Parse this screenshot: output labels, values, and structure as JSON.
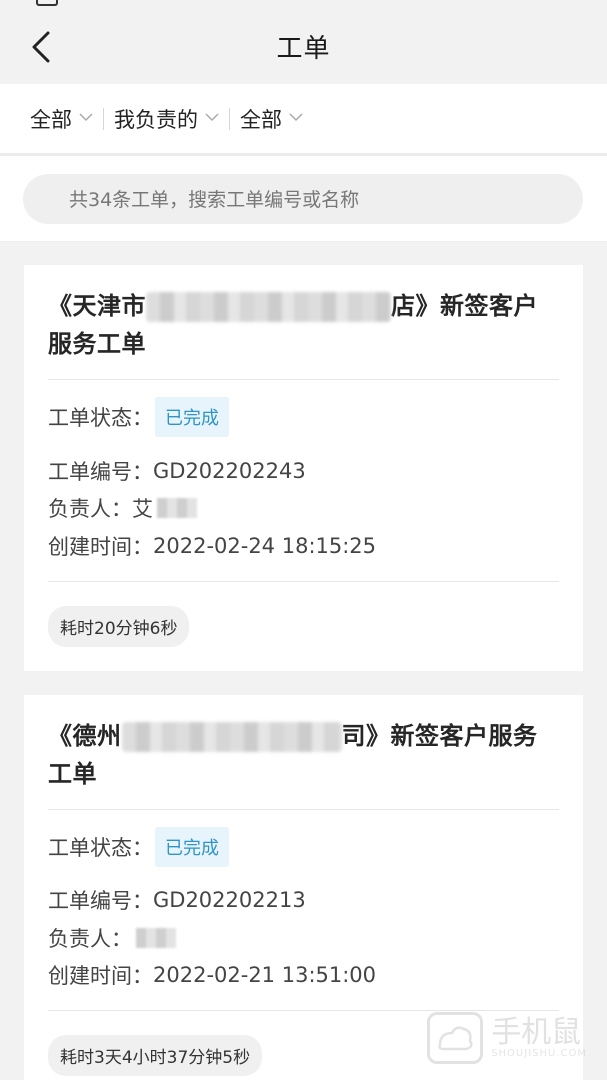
{
  "header": {
    "title": "工单"
  },
  "filters": [
    {
      "label": "全部"
    },
    {
      "label": "我负责的"
    },
    {
      "label": "全部"
    }
  ],
  "search": {
    "placeholder": "共34条工单，搜索工单编号或名称"
  },
  "cards": [
    {
      "title_prefix": "《天津市",
      "title_suffix": "店》新签客户",
      "title_line2": "服务工单",
      "status_label": "工单状态：",
      "status_value": "已完成",
      "number_label": "工单编号：",
      "number_value": "GD202202243",
      "owner_label": "负责人：",
      "owner_value": "艾",
      "created_label": "创建时间：",
      "created_value": "2022-02-24 18:15:25",
      "duration": "耗时20分钟6秒"
    },
    {
      "title_prefix": "《德州",
      "title_suffix": "司》新签客户服务",
      "title_line2": "工单",
      "status_label": "工单状态：",
      "status_value": "已完成",
      "number_label": "工单编号：",
      "number_value": "GD202202213",
      "owner_label": "负责人：",
      "owner_value": "",
      "created_label": "创建时间：",
      "created_value": "2022-02-21 13:51:00",
      "duration": "耗时3天4小时37分钟5秒"
    }
  ],
  "watermark": {
    "text": "手机鼠",
    "sub": "SHOUJISHU.COM"
  },
  "colors": {
    "badge_text": "#2e94c9",
    "badge_bg": "#e8f4fb",
    "page_bg": "#f2f2f2"
  }
}
